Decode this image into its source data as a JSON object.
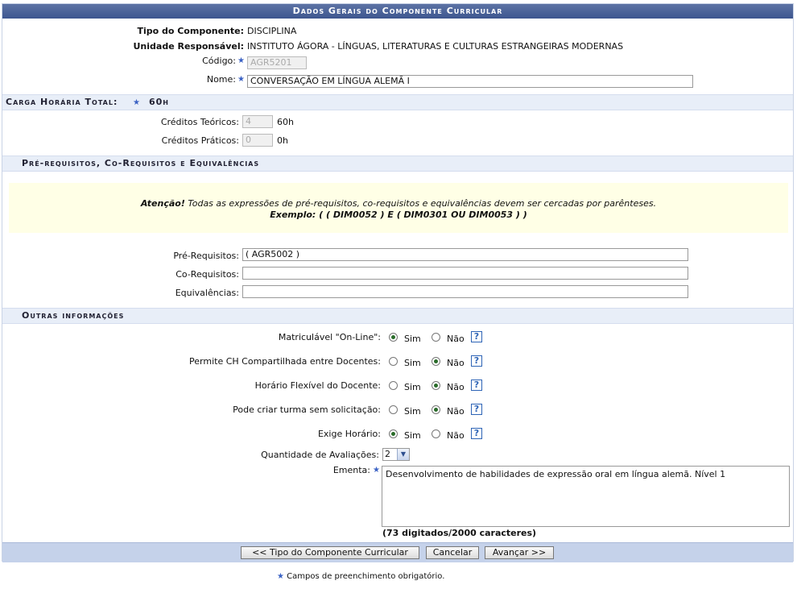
{
  "panel": {
    "title": "Dados Gerais do Componente Curricular"
  },
  "general": {
    "tipo_label": "Tipo do Componente:",
    "tipo_value": "DISCIPLINA",
    "unidade_label": "Unidade Responsável:",
    "unidade_value": "INSTITUTO ÁGORA - LÍNGUAS, LITERATURAS E CULTURAS ESTRANGEIRAS MODERNAS",
    "codigo_label": "Código:",
    "codigo_value": "AGR5201",
    "nome_label": "Nome:",
    "nome_value": "CONVERSAÇÃO EM LÍNGUA ALEMÃ I"
  },
  "carga": {
    "label": "Carga Horária Total:",
    "value": "60h",
    "teoricos_label": "Créditos Teóricos:",
    "teoricos_value": "4",
    "teoricos_hours": "60h",
    "praticos_label": "Créditos Práticos:",
    "praticos_value": "0",
    "praticos_hours": "0h"
  },
  "requisitos": {
    "section_title": "Pré-requisitos, Co-Requisitos e Equivalências",
    "note_strong": "Atenção!",
    "note_text": " Todas as expressões de pré-requisitos, co-requisitos e equivalências devem ser cercadas por parênteses.",
    "note_example": "Exemplo: ( ( DIM0052 ) E ( DIM0301 OU DIM0053 ) )",
    "pre_label": "Pré-Requisitos:",
    "pre_value": "( AGR5002 )",
    "co_label": "Co-Requisitos:",
    "co_value": "",
    "equiv_label": "Equivalências:",
    "equiv_value": ""
  },
  "outras": {
    "section_title": "Outras informações",
    "sim": "Sim",
    "nao": "Não",
    "help": "?",
    "matriculavel_label": "Matriculável \"On-Line\":",
    "compartilhada_label": "Permite CH Compartilhada entre Docentes:",
    "flexivel_label": "Horário Flexível do Docente:",
    "turma_label": "Pode criar turma sem solicitação:",
    "exige_label": "Exige Horário:",
    "avaliacoes_label": "Quantidade de Avaliações:",
    "avaliacoes_value": "2",
    "ementa_label": "Ementa:",
    "ementa_value": "Desenvolvimento de habilidades de expressão oral em língua alemã. Nível 1",
    "counter": "(73 digitados/2000 caracteres)"
  },
  "buttons": {
    "back": "<< Tipo do Componente Curricular",
    "cancel": "Cancelar",
    "next": "Avançar >>"
  },
  "legend": {
    "text": "Campos de preenchimento obrigatório."
  },
  "colors": {
    "title_bar": "#3d568f",
    "section_bg": "#e8eef8",
    "note_bg": "#ffffe6",
    "required_star": "#3b62c4"
  }
}
